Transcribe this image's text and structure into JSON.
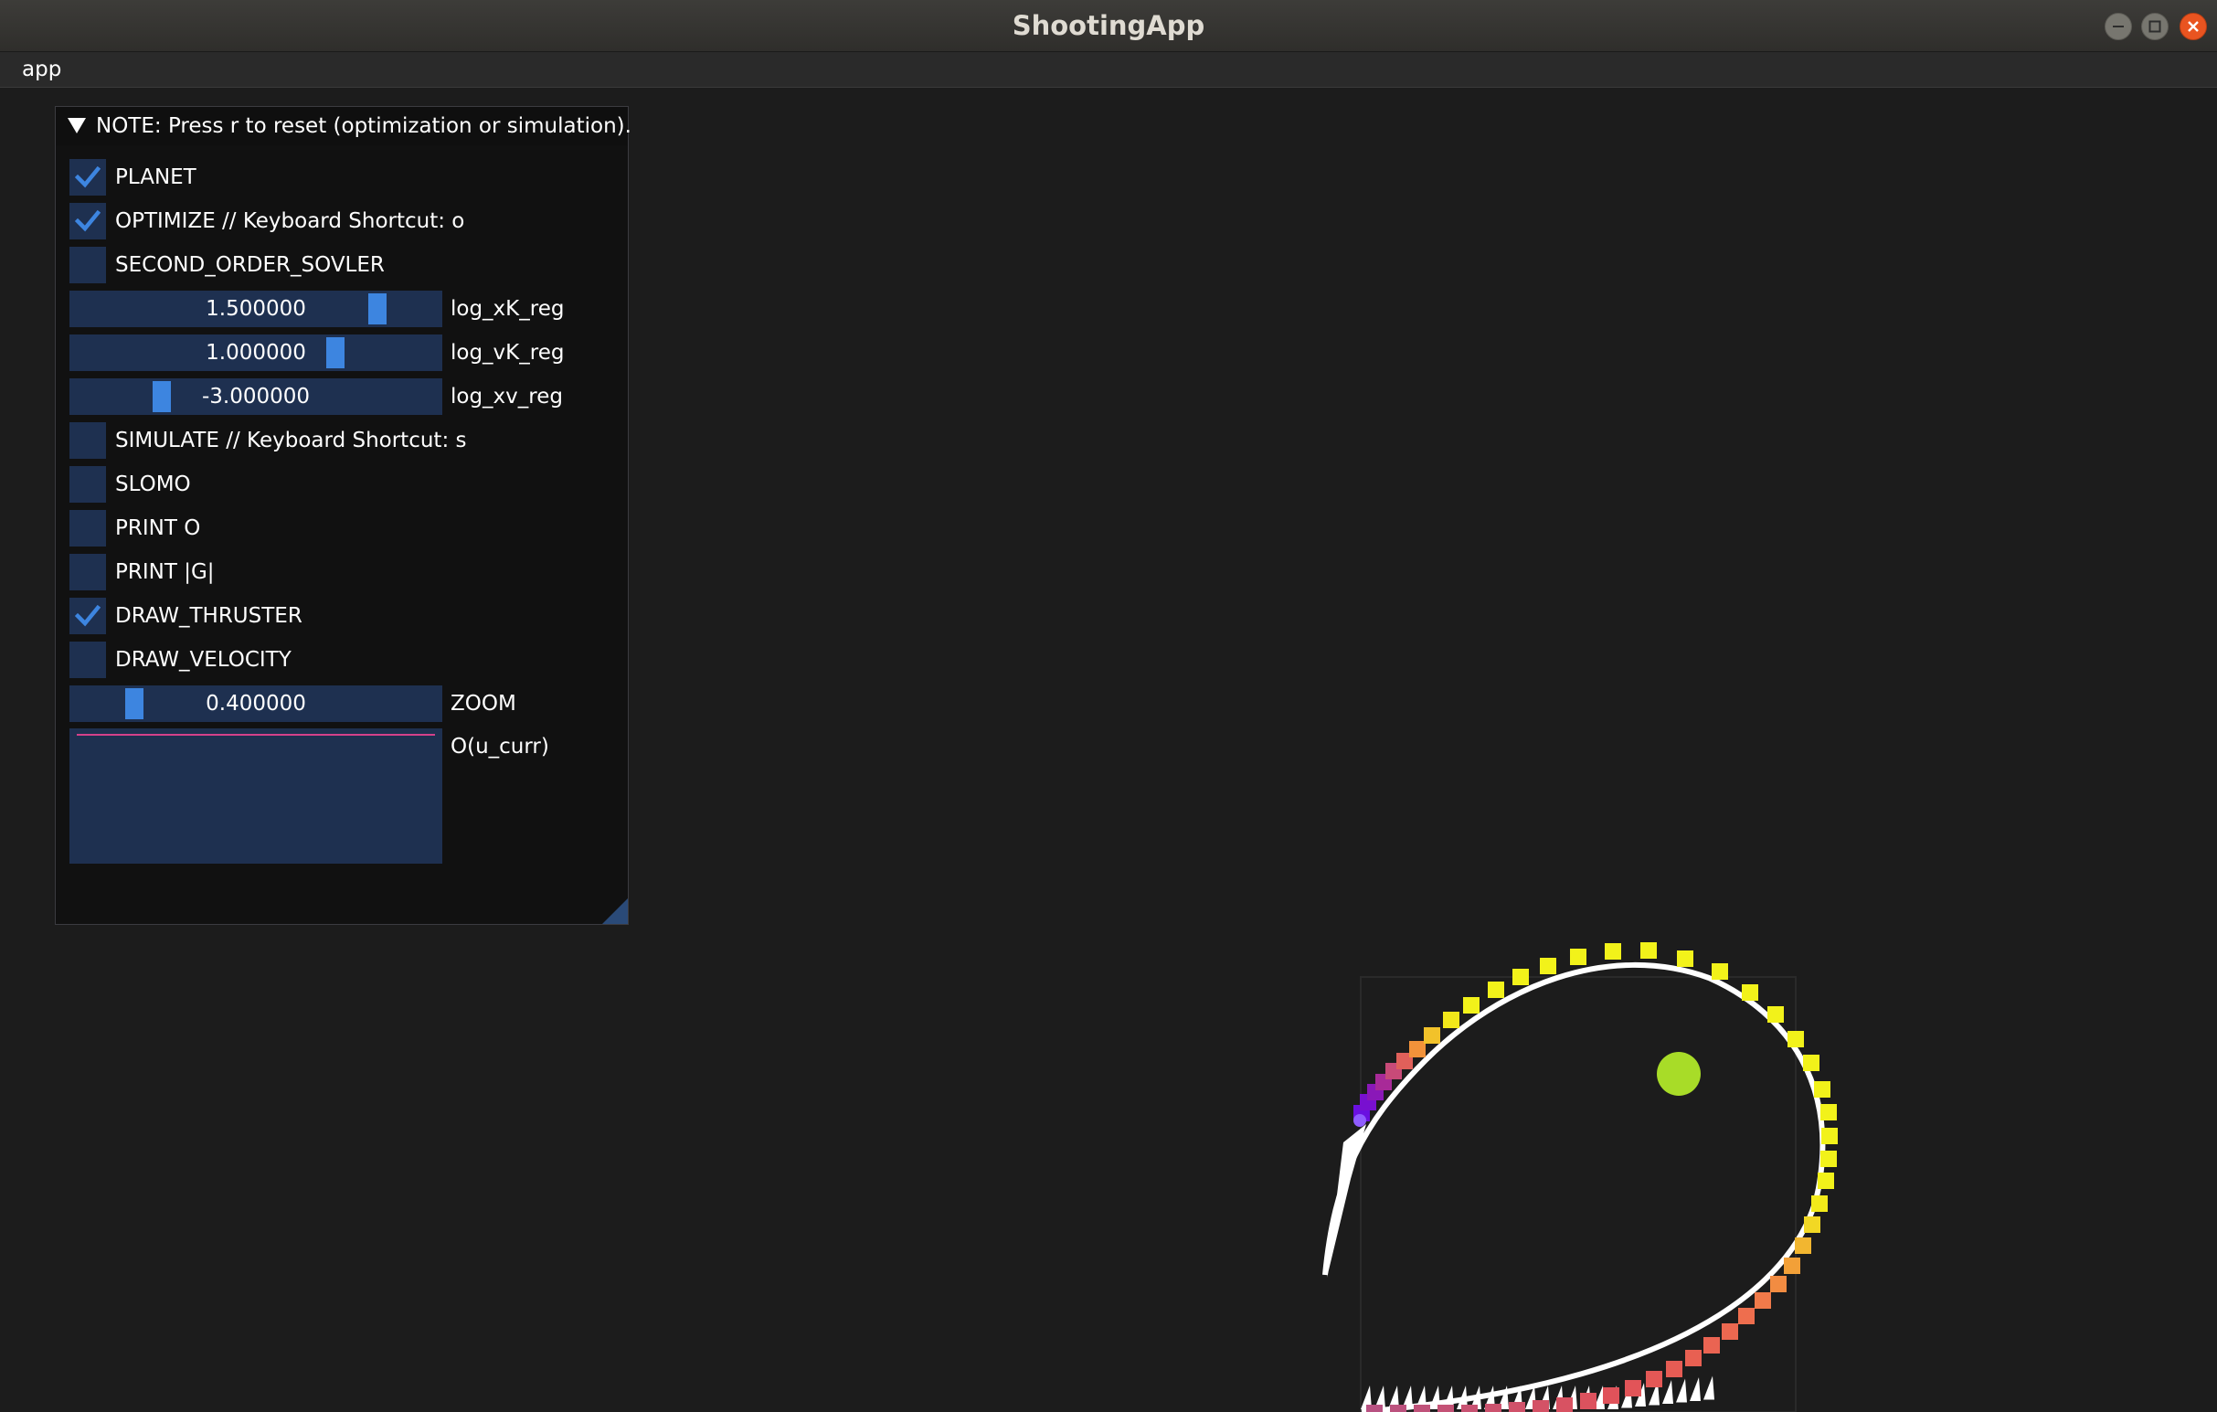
{
  "window": {
    "title": "ShootingApp"
  },
  "menu": {
    "app_label": "app"
  },
  "panel": {
    "title": "NOTE: Press r to reset (optimization or simulation).",
    "rows": [
      {
        "kind": "checkbox",
        "label": "PLANET",
        "checked": true
      },
      {
        "kind": "checkbox",
        "label": "OPTIMIZE // Keyboard Shortcut: o",
        "checked": true
      },
      {
        "kind": "checkbox",
        "label": "SECOND_ORDER_SOVLER",
        "checked": false
      },
      {
        "kind": "slider",
        "label": "log_xK_reg",
        "value": "1.500000",
        "fraction": 0.85
      },
      {
        "kind": "slider",
        "label": "log_vK_reg",
        "value": "1.000000",
        "fraction": 0.73
      },
      {
        "kind": "slider",
        "label": "log_xv_reg",
        "value": "-3.000000",
        "fraction": 0.23
      },
      {
        "kind": "checkbox",
        "label": "SIMULATE // Keyboard Shortcut: s",
        "checked": false
      },
      {
        "kind": "checkbox",
        "label": "SLOMO",
        "checked": false
      },
      {
        "kind": "checkbox",
        "label": "PRINT  O",
        "checked": false
      },
      {
        "kind": "checkbox",
        "label": "PRINT |G|",
        "checked": false
      },
      {
        "kind": "checkbox",
        "label": "DRAW_THRUSTER",
        "checked": true
      },
      {
        "kind": "checkbox",
        "label": "DRAW_VELOCITY",
        "checked": false
      },
      {
        "kind": "slider",
        "label": "ZOOM",
        "value": "0.400000",
        "fraction": 0.15
      }
    ],
    "plot": {
      "label": "O(u_curr)"
    }
  },
  "colors": {
    "background": "#1c1c1c",
    "panel_bg": "#111111",
    "widget_bg": "#1e3050",
    "accent": "#3d85e0",
    "planet": "#a8dc28",
    "plot_line": "#d4418a",
    "close_button": "#e95420"
  },
  "icons": {
    "minimize": "minimize-icon",
    "maximize": "maximize-icon",
    "close": "close-icon",
    "checkmark": "checkmark-icon",
    "collapse": "collapse-triangle-icon"
  }
}
